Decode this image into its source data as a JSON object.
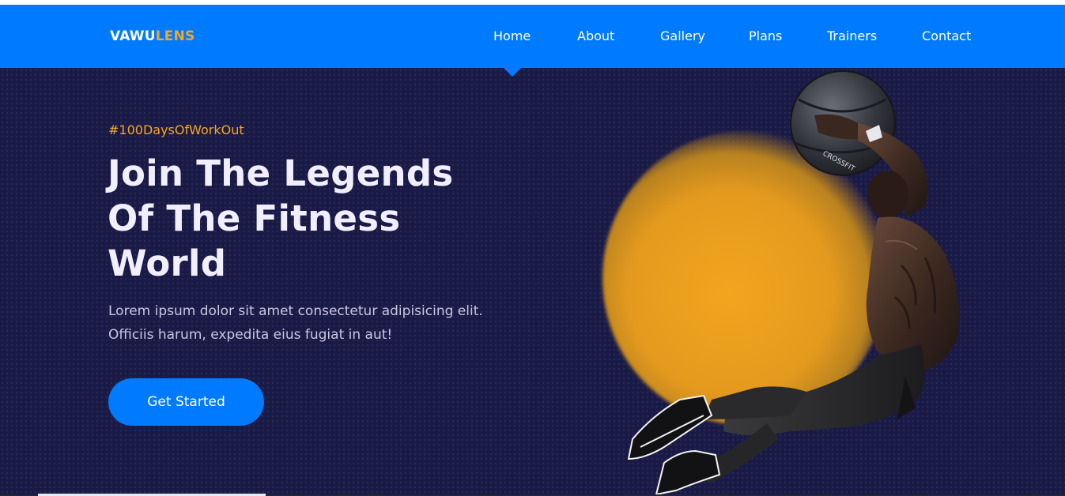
{
  "brand": {
    "part1": "VAWU",
    "part2": "LENS",
    "primary_color": "#007bff",
    "accent_color": "#f5a623",
    "hero_background": "#1a1a47"
  },
  "nav": {
    "items": [
      {
        "label": "Home",
        "active": true
      },
      {
        "label": "About"
      },
      {
        "label": "Gallery"
      },
      {
        "label": "Plans"
      },
      {
        "label": "Trainers"
      },
      {
        "label": "Contact"
      }
    ]
  },
  "hero": {
    "tagline": "#100DaysOfWorkOut",
    "headline": [
      "Join The Legends",
      "Of The Fitness",
      "World"
    ],
    "description": [
      "Lorem ipsum dolor sit amet consectetur adipisicing elit.",
      "Officiis harum, expedita eius fugiat in aut!"
    ],
    "cta_label": "Get Started",
    "image": {
      "icon": "athlete-with-medicine-ball-image",
      "ball_text": "CROSSFIT"
    }
  }
}
